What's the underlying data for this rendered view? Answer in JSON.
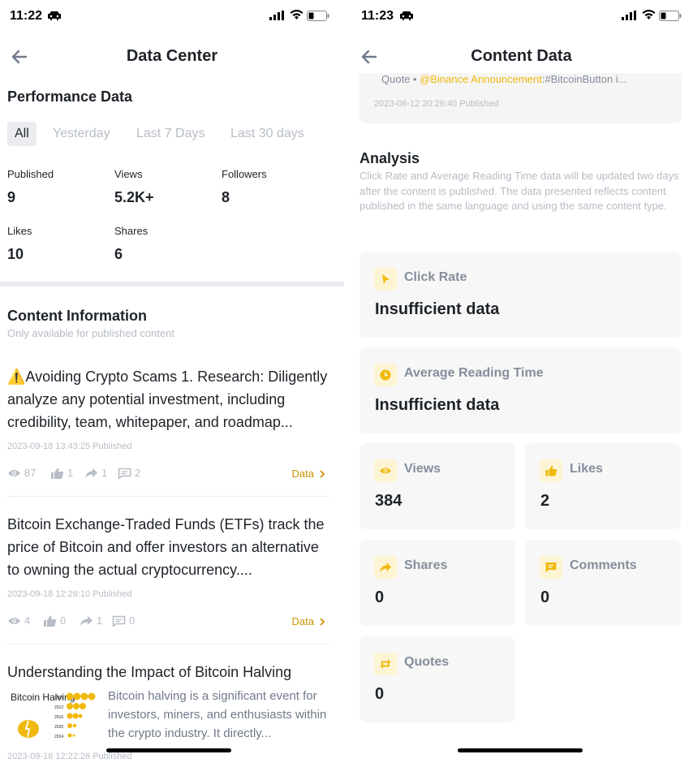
{
  "left": {
    "status": {
      "time": "11:22"
    },
    "nav": {
      "title": "Data Center"
    },
    "performance": {
      "title": "Performance Data",
      "tabs": [
        "All",
        "Yesterday",
        "Last 7 Days",
        "Last 30 days"
      ],
      "active_tab": "All",
      "stats": [
        {
          "label": "Published",
          "value": "9"
        },
        {
          "label": "Views",
          "value": "5.2K+"
        },
        {
          "label": "Followers",
          "value": "8"
        },
        {
          "label": "Likes",
          "value": "10"
        },
        {
          "label": "Shares",
          "value": "6"
        }
      ]
    },
    "content_info": {
      "title": "Content Information",
      "subtitle": "Only available for published content",
      "data_link": "Data",
      "articles": [
        {
          "emoji": "⚠️",
          "title": "Avoiding Crypto Scams 1. Research: Diligently analyze any potential investment, including credibility, team, whitepaper, and roadmap...",
          "date": "2023-09-18 13:43:25 Published",
          "views": "87",
          "likes": "1",
          "shares": "1",
          "comments": "2"
        },
        {
          "title": "Bitcoin Exchange-Traded Funds (ETFs) track the price of Bitcoin and offer investors an alternative to owning the actual cryptocurrency....",
          "date": "2023-09-18 12:26:10 Published",
          "views": "4",
          "likes": "0",
          "shares": "1",
          "comments": "0"
        },
        {
          "title": "Understanding the Impact of Bitcoin Halving",
          "thumb_caption": "Bitcoin Halving",
          "thumb_years": [
            "2009",
            "2012",
            "2016",
            "2020",
            "2024"
          ],
          "excerpt": "Bitcoin halving is a significant event for investors, miners, and enthusiasts within the crypto industry. It directly...",
          "date": "2023-09-18 12:22:26 Published"
        }
      ]
    }
  },
  "right": {
    "status": {
      "time": "11:23"
    },
    "nav": {
      "title": "Content Data"
    },
    "quote": {
      "prefix": "Quote • ",
      "handle": "@Binance Announcement",
      "text": ":#BitcoinButton i...",
      "date": "2023-06-12 20:26:40 Published"
    },
    "analysis": {
      "title": "Analysis",
      "description": "Click Rate and Average Reading Time data will be updated two days after the content is published. The data presented reflects content published in the same language and using the same content type."
    },
    "cards": {
      "click_rate": {
        "label": "Click Rate",
        "value": "Insufficient data",
        "icon": "cursor-icon"
      },
      "avg_reading": {
        "label": "Average Reading Time",
        "value": "Insufficient data",
        "icon": "clock-icon"
      },
      "views": {
        "label": "Views",
        "value": "384",
        "icon": "eye-icon"
      },
      "likes": {
        "label": "Likes",
        "value": "2",
        "icon": "thumbs-up-icon"
      },
      "shares": {
        "label": "Shares",
        "value": "0",
        "icon": "share-arrow-icon"
      },
      "comments": {
        "label": "Comments",
        "value": "0",
        "icon": "comment-icon"
      },
      "quotes": {
        "label": "Quotes",
        "value": "0",
        "icon": "repost-icon"
      }
    }
  },
  "colors": {
    "accent": "#F0B90B",
    "accent_text": "#C99400",
    "muted": "#B7BDC6",
    "card_bg": "#F7F7F7"
  }
}
